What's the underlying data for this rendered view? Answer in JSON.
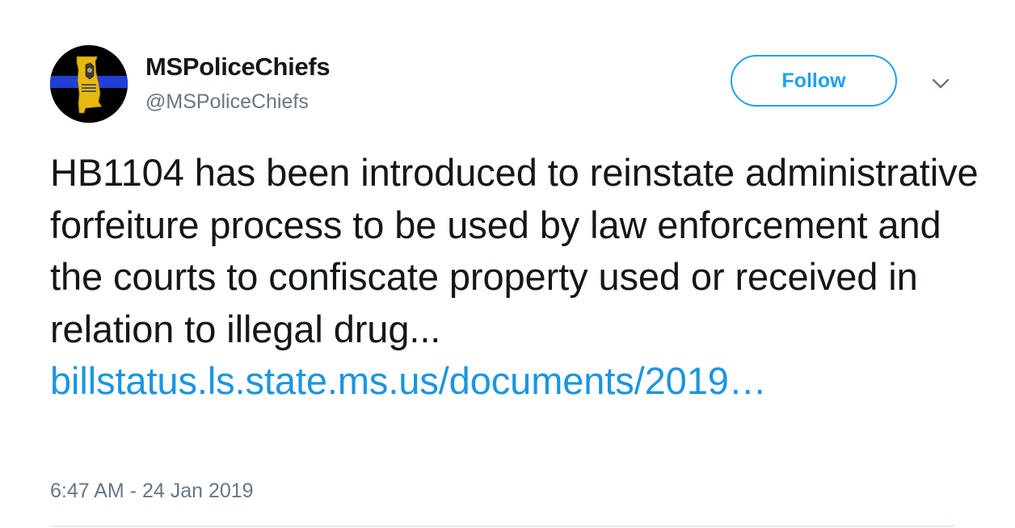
{
  "tweet": {
    "author": {
      "display_name": "MSPoliceChiefs",
      "handle": "@MSPoliceChiefs",
      "avatar_icon": "mississippi-police-badge-logo"
    },
    "follow_label": "Follow",
    "more_icon": "chevron-down-icon",
    "text": "HB1104 has been introduced to reinstate administrative forfeiture process to be used by law enforcement and the courts to confiscate property used or received in relation to illegal drug...",
    "link_text": "billstatus.ls.state.ms.us/documents/2019…",
    "timestamp": "6:47 AM - 24 Jan 2019"
  },
  "colors": {
    "accent": "#1da1f2",
    "link": "#1b95e0",
    "muted": "#657786",
    "text": "#14171a",
    "avatar_stripe": "#1f3fd6",
    "badge_gold": "#e8b80e"
  }
}
